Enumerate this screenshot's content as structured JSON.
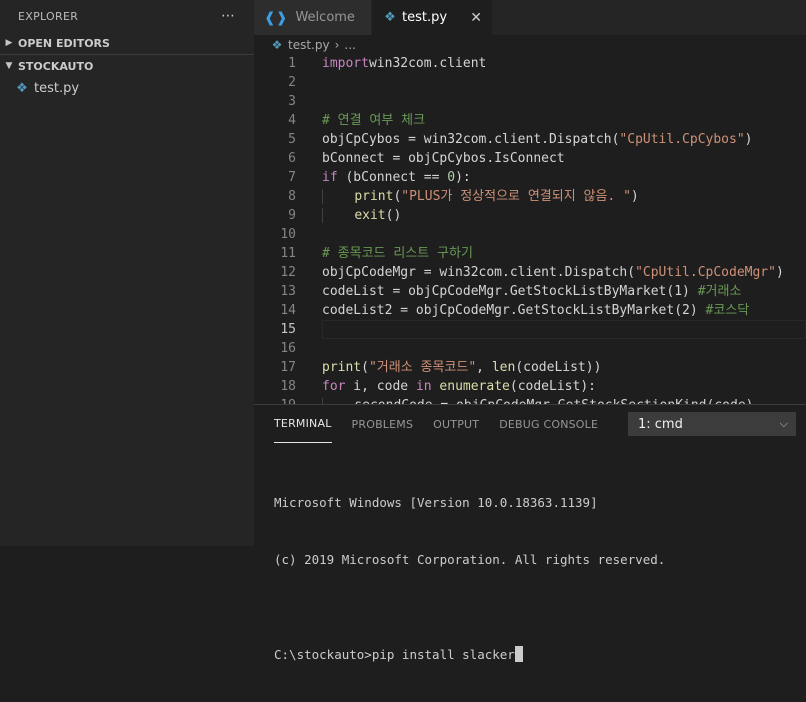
{
  "sidebar": {
    "title": "EXPLORER",
    "more_icon": "⋯",
    "sections": [
      {
        "label": "OPEN EDITORS",
        "expanded": false
      },
      {
        "label": "STOCKAUTO",
        "expanded": true
      }
    ],
    "files": [
      {
        "name": "test.py",
        "icon": "python-icon"
      }
    ]
  },
  "tabs": [
    {
      "label": "Welcome",
      "icon": "vscode-icon",
      "active": false
    },
    {
      "label": "test.py",
      "icon": "python-icon",
      "active": true,
      "close": "✕"
    }
  ],
  "breadcrumb": {
    "file": "test.py",
    "separator": "›",
    "more": "..."
  },
  "editor": {
    "current_line": 15,
    "lines": [
      {
        "n": "1",
        "tokens": [
          [
            "kw",
            "import"
          ],
          [
            "",
            "win32com.client"
          ]
        ]
      },
      {
        "n": "2",
        "tokens": []
      },
      {
        "n": "3",
        "tokens": []
      },
      {
        "n": "4",
        "tokens": [
          [
            "cm",
            "# 연결 여부 체크"
          ]
        ]
      },
      {
        "n": "5",
        "tokens": [
          [
            "",
            "objCpCybos = win32com.client.Dispatch("
          ],
          [
            "st",
            "\"CpUtil.CpCybos\""
          ],
          [
            "",
            ")"
          ]
        ]
      },
      {
        "n": "6",
        "tokens": [
          [
            "",
            "bConnect = objCpCybos.IsConnect"
          ]
        ]
      },
      {
        "n": "7",
        "tokens": [
          [
            "kw",
            "if"
          ],
          [
            "",
            " (bConnect == "
          ],
          [
            "nm",
            "0"
          ],
          [
            "",
            "):"
          ]
        ]
      },
      {
        "n": "8",
        "indent": 1,
        "tokens": [
          [
            "fn",
            "print"
          ],
          [
            "",
            "("
          ],
          [
            "st",
            "\"PLUS가 정상적으로 연결되지 않음. \""
          ],
          [
            "",
            ")"
          ]
        ]
      },
      {
        "n": "9",
        "indent": 1,
        "tokens": [
          [
            "fn",
            "exit"
          ],
          [
            "",
            "()"
          ]
        ]
      },
      {
        "n": "10",
        "tokens": []
      },
      {
        "n": "11",
        "tokens": [
          [
            "cm",
            "# 종목코드 리스트 구하기"
          ]
        ]
      },
      {
        "n": "12",
        "tokens": [
          [
            "",
            "objCpCodeMgr = win32com.client.Dispatch("
          ],
          [
            "st",
            "\"CpUtil.CpCodeMgr\""
          ],
          [
            "",
            ")"
          ]
        ]
      },
      {
        "n": "13",
        "tokens": [
          [
            "",
            "codeList = objCpCodeMgr.GetStockListByMarket(1) "
          ],
          [
            "cm",
            "#거래소"
          ]
        ]
      },
      {
        "n": "14",
        "tokens": [
          [
            "",
            "codeList2 = objCpCodeMgr.GetStockListByMarket(2) "
          ],
          [
            "cm",
            "#코스닥"
          ]
        ]
      },
      {
        "n": "15",
        "tokens": []
      },
      {
        "n": "16",
        "tokens": []
      },
      {
        "n": "17",
        "tokens": [
          [
            "fn",
            "print"
          ],
          [
            "",
            "("
          ],
          [
            "st",
            "\"거래소 종목코드\""
          ],
          [
            "",
            ", "
          ],
          [
            "fn",
            "len"
          ],
          [
            "",
            "(codeList))"
          ]
        ]
      },
      {
        "n": "18",
        "tokens": [
          [
            "kw",
            "for"
          ],
          [
            "",
            " i, code "
          ],
          [
            "kw",
            "in"
          ],
          [
            "",
            " "
          ],
          [
            "fn",
            "enumerate"
          ],
          [
            "",
            "(codeList):"
          ]
        ]
      },
      {
        "n": "19",
        "indent": 1,
        "tokens": [
          [
            "",
            "secondCode = objCpCodeMgr.GetStockSectionKind(code)"
          ]
        ]
      }
    ]
  },
  "panel": {
    "tabs": [
      {
        "label": "TERMINAL",
        "active": true
      },
      {
        "label": "PROBLEMS",
        "active": false
      },
      {
        "label": "OUTPUT",
        "active": false
      },
      {
        "label": "DEBUG CONSOLE",
        "active": false
      }
    ],
    "terminal_select": "1: cmd",
    "terminal_lines": [
      "Microsoft Windows [Version 10.0.18363.1139]",
      "(c) 2019 Microsoft Corporation. All rights reserved.",
      "",
      "C:\\stockauto>pip install slacker"
    ]
  }
}
